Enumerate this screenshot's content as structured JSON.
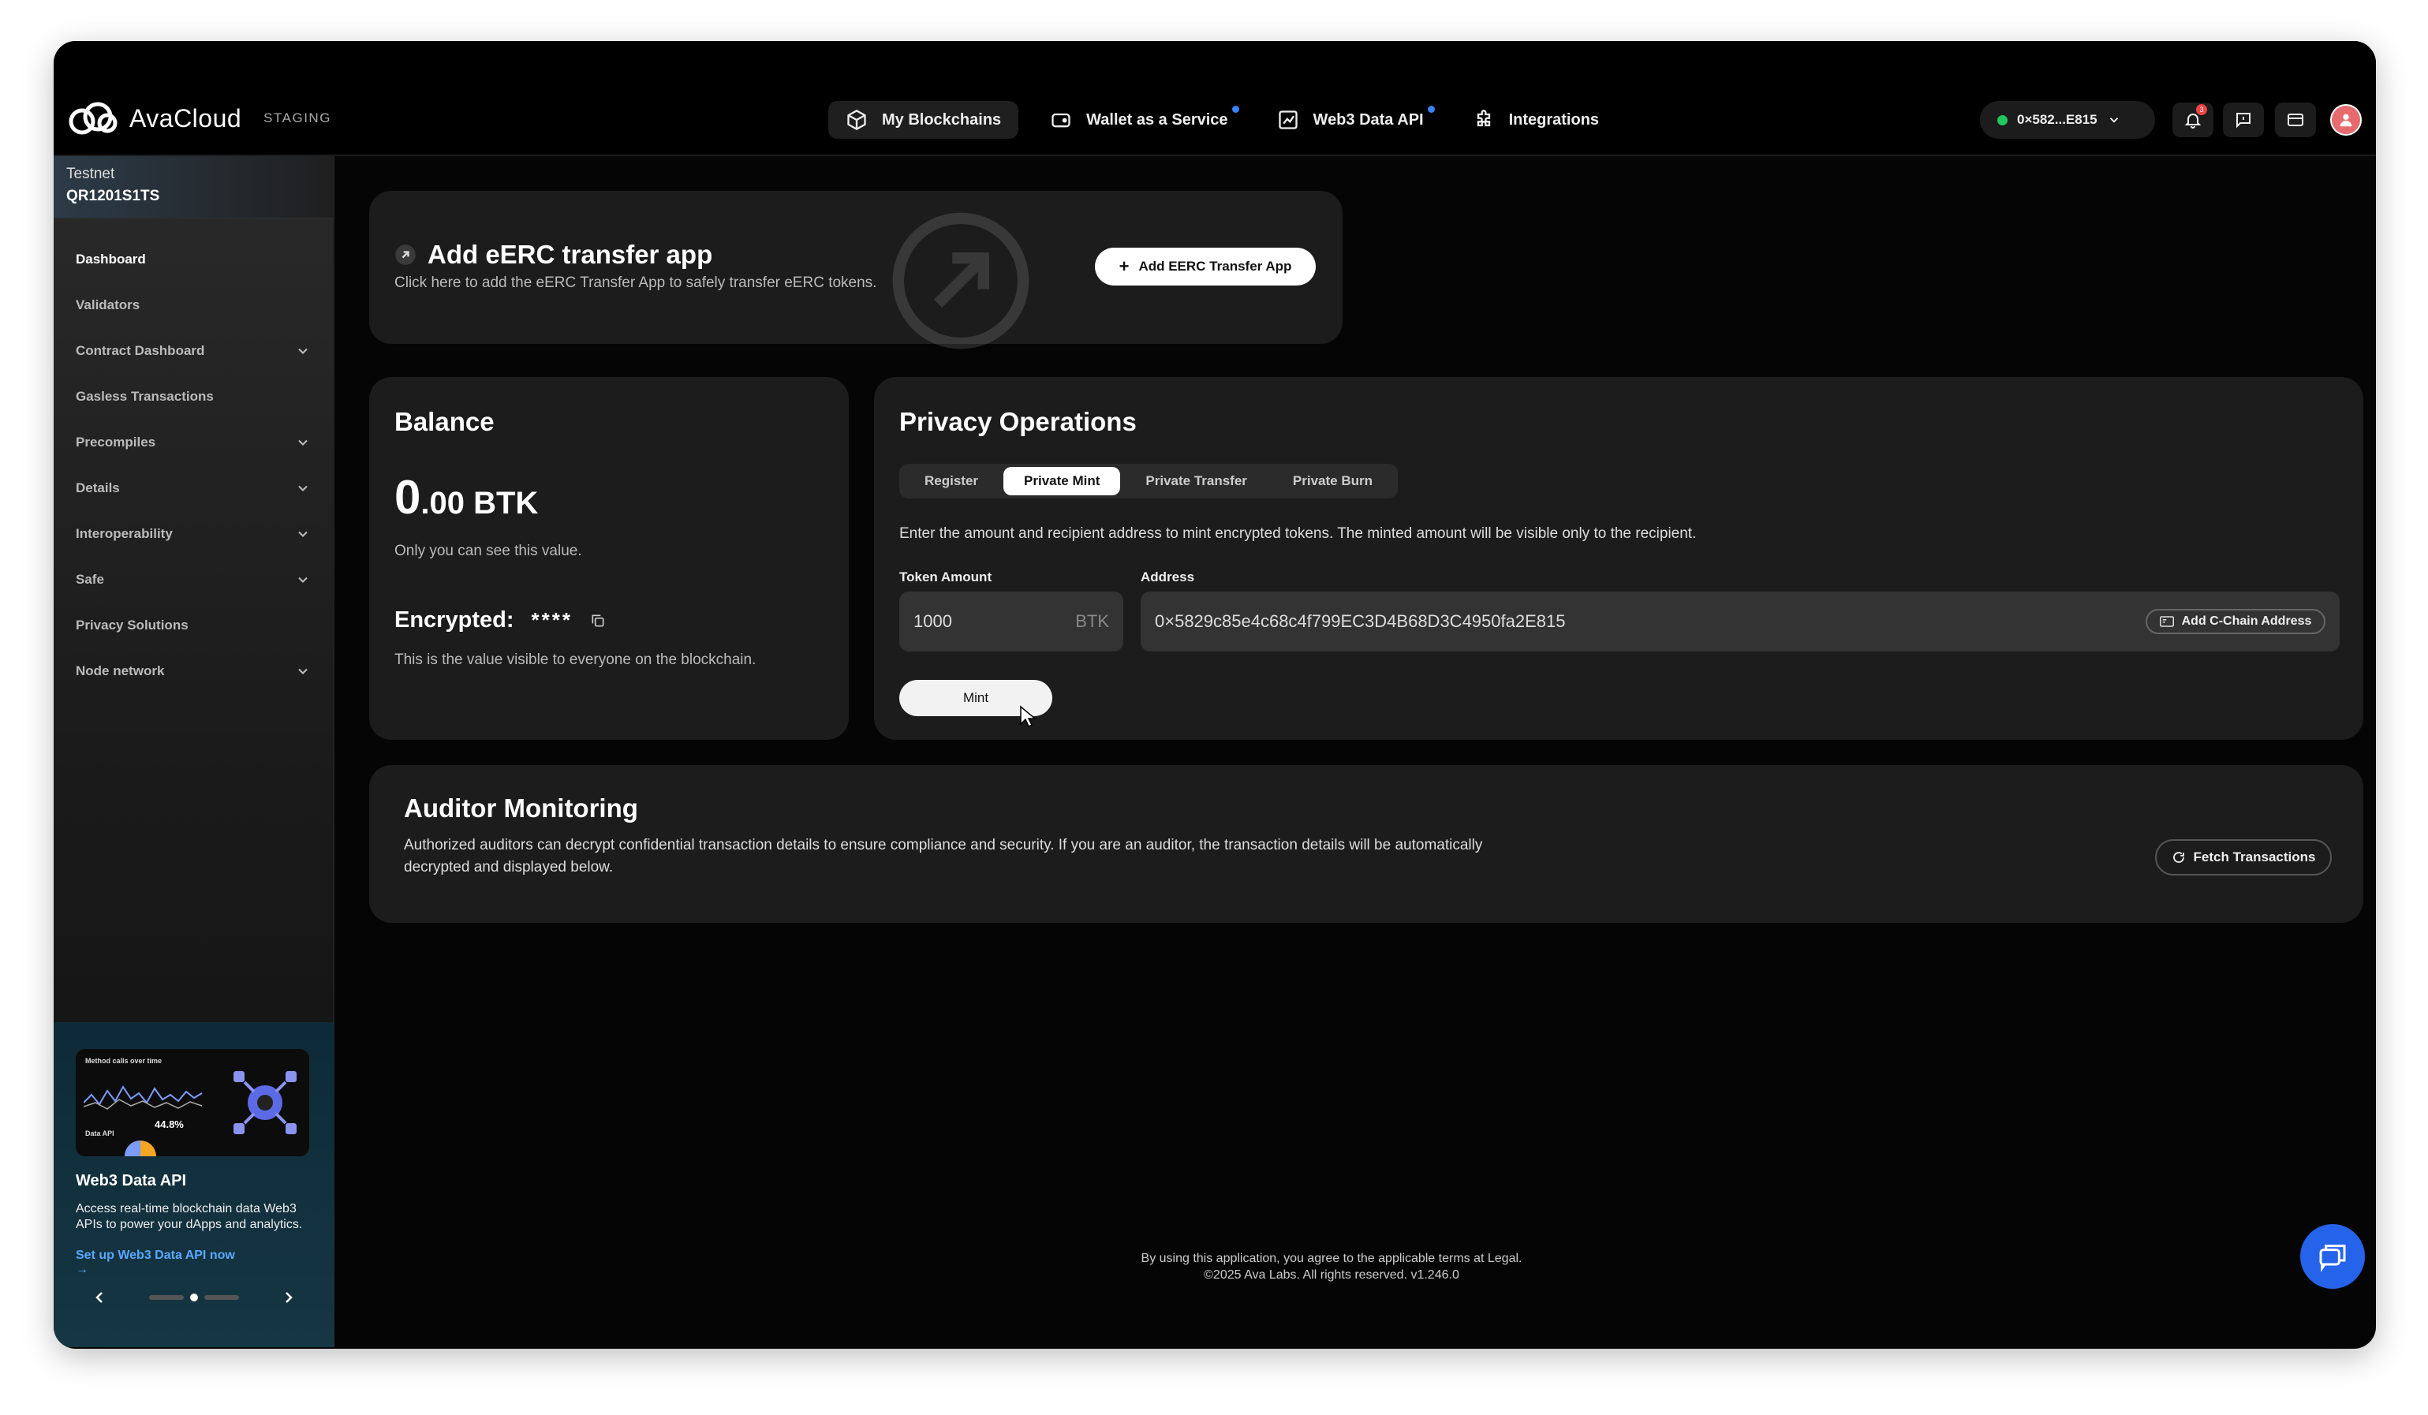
{
  "header": {
    "logo_text": "AvaCloud",
    "env_tag": "STAGING",
    "nav": [
      {
        "label": "My Blockchains",
        "active": true
      },
      {
        "label": "Wallet as a Service",
        "dot": true
      },
      {
        "label": "Web3 Data API",
        "dot": true
      },
      {
        "label": "Integrations"
      }
    ],
    "wallet_address": "0×582...E815",
    "notification_count": "3"
  },
  "sidebar": {
    "network_label": "Testnet",
    "network_name": "QR1201S1TS",
    "items": [
      {
        "label": "Dashboard",
        "active": true
      },
      {
        "label": "Validators"
      },
      {
        "label": "Contract Dashboard",
        "expandable": true
      },
      {
        "label": "Gasless Transactions"
      },
      {
        "label": "Precompiles",
        "expandable": true
      },
      {
        "label": "Details",
        "expandable": true
      },
      {
        "label": "Interoperability",
        "expandable": true
      },
      {
        "label": "Safe",
        "expandable": true
      },
      {
        "label": "Privacy Solutions"
      },
      {
        "label": "Node network",
        "expandable": true
      }
    ],
    "promo": {
      "img_chart_title": "Method calls over time",
      "img_label": "Data API",
      "img_percent": "44.8%",
      "title": "Web3 Data API",
      "description": "Access real-time blockchain data Web3 APIs to power your dApps and analytics.",
      "link": "Set up Web3 Data API now",
      "link_arrow": "→"
    }
  },
  "add_app": {
    "title": "Add eERC transfer app",
    "subtitle": "Click here to add the eERC Transfer App to safely transfer eERC tokens.",
    "button": "Add EERC Transfer App"
  },
  "balance": {
    "title": "Balance",
    "amount_int": "0",
    "amount_dec": ".00 BTK",
    "note": "Only you can see this value.",
    "encrypted_label": "Encrypted:",
    "encrypted_value": "****",
    "encrypted_note": "This is the value visible to everyone on the blockchain."
  },
  "privacy": {
    "title": "Privacy Operations",
    "tabs": [
      "Register",
      "Private Mint",
      "Private Transfer",
      "Private Burn"
    ],
    "active_tab": 1,
    "instructions": "Enter the amount and recipient address to mint encrypted tokens. The minted amount will be visible only to the recipient.",
    "token_amount_label": "Token Amount",
    "token_amount_value": "1000",
    "token_unit": "BTK",
    "address_label": "Address",
    "address_value": "0×5829c85e4c68c4f799EC3D4B68D3C4950fa2E815",
    "add_address_button": "Add C-Chain Address",
    "mint_button": "Mint"
  },
  "auditor": {
    "title": "Auditor Monitoring",
    "description": "Authorized auditors can decrypt confidential transaction details to ensure compliance and security. If you are an auditor, the transaction details will be automatically decrypted and displayed below.",
    "fetch_button": "Fetch Transactions"
  },
  "footer": {
    "line1": "By using this application, you agree to the applicable terms at Legal.",
    "line2": "©2025 Ava Labs.  All rights reserved.  v1.246.0"
  }
}
